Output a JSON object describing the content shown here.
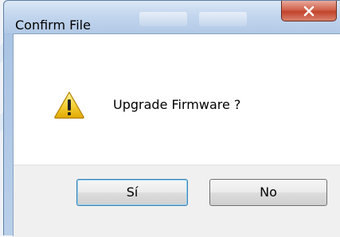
{
  "window": {
    "title": "Confirm File"
  },
  "titlebar": {
    "close_icon": "close-icon"
  },
  "dialog": {
    "icon": "warning-icon",
    "message": "Upgrade Firmware ?"
  },
  "buttons": {
    "yes_label": "Sí",
    "no_label": "No"
  },
  "colors": {
    "close_button": "#c2442c",
    "warning_yellow": "#f5c518",
    "default_button_border": "#3c7fb1"
  }
}
